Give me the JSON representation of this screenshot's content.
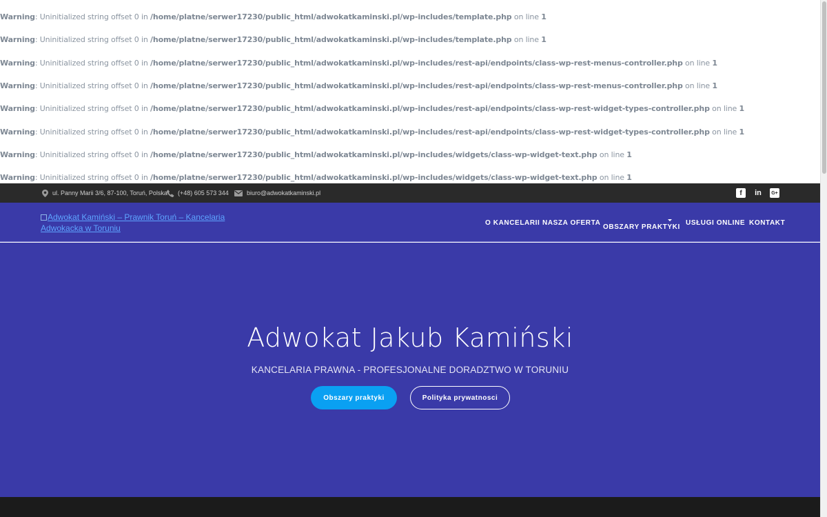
{
  "warnings": [
    {
      "label": "Warning",
      "message": ": Uninitialized string offset 0 in ",
      "path": "/home/platne/serwer17230/public_html/adwokatkaminski.pl/wp-includes/template.php",
      "suffix": " on line ",
      "line": "1"
    },
    {
      "label": "Warning",
      "message": ": Uninitialized string offset 0 in ",
      "path": "/home/platne/serwer17230/public_html/adwokatkaminski.pl/wp-includes/template.php",
      "suffix": " on line ",
      "line": "1"
    },
    {
      "label": "Warning",
      "message": ": Uninitialized string offset 0 in ",
      "path": "/home/platne/serwer17230/public_html/adwokatkaminski.pl/wp-includes/rest-api/endpoints/class-wp-rest-menus-controller.php",
      "suffix": " on line ",
      "line": "1"
    },
    {
      "label": "Warning",
      "message": ": Uninitialized string offset 0 in ",
      "path": "/home/platne/serwer17230/public_html/adwokatkaminski.pl/wp-includes/rest-api/endpoints/class-wp-rest-menus-controller.php",
      "suffix": " on line ",
      "line": "1"
    },
    {
      "label": "Warning",
      "message": ": Uninitialized string offset 0 in ",
      "path": "/home/platne/serwer17230/public_html/adwokatkaminski.pl/wp-includes/rest-api/endpoints/class-wp-rest-widget-types-controller.php",
      "suffix": " on line ",
      "line": "1"
    },
    {
      "label": "Warning",
      "message": ": Uninitialized string offset 0 in ",
      "path": "/home/platne/serwer17230/public_html/adwokatkaminski.pl/wp-includes/rest-api/endpoints/class-wp-rest-widget-types-controller.php",
      "suffix": " on line ",
      "line": "1"
    },
    {
      "label": "Warning",
      "message": ": Uninitialized string offset 0 in ",
      "path": "/home/platne/serwer17230/public_html/adwokatkaminski.pl/wp-includes/widgets/class-wp-widget-text.php",
      "suffix": " on line ",
      "line": "1"
    },
    {
      "label": "Warning",
      "message": ": Uninitialized string offset 0 in ",
      "path": "/home/platne/serwer17230/public_html/adwokatkaminski.pl/wp-includes/widgets/class-wp-widget-text.php",
      "suffix": " on line ",
      "line": "1"
    }
  ],
  "topbar": {
    "address": "ul. Panny Marii 3/6, 87-100, Toruń, Polska",
    "phone": "(+48) 605 573 344",
    "email": "biuro@adwokatkaminski.pl",
    "icons": {
      "address": "map-marker-icon",
      "phone": "phone-icon",
      "email": "envelope-icon"
    },
    "social": [
      {
        "name": "facebook-icon",
        "glyph": "f"
      },
      {
        "name": "linkedin-icon",
        "glyph": "in"
      },
      {
        "name": "google-plus-icon",
        "glyph": "G+"
      }
    ]
  },
  "nav": {
    "logo_alt": "Adwokat Kamiński – Prawnik Toruń – Kancelaria Adwokacka w Toruniu",
    "items": [
      "O KANCELARII",
      "NASZA OFERTA",
      "OBSZARY PRAKTYKI",
      "USŁUGI ONLINE",
      "KONTAKT"
    ]
  },
  "hero": {
    "title": "Adwokat Jakub Kamiński",
    "subtitle": "KANCELARIA PRAWNA - PROFESJONALNE DORADZTWO W TORUNIU",
    "primary_button": "Obszary praktyki",
    "secondary_button": "Polityka prywatnosci"
  },
  "colors": {
    "hero_bg": "#3a3aa8",
    "topbar_bg": "#2a2a2a",
    "primary_button": "#0aa0f2",
    "footer_bg": "#1b1b1b"
  }
}
